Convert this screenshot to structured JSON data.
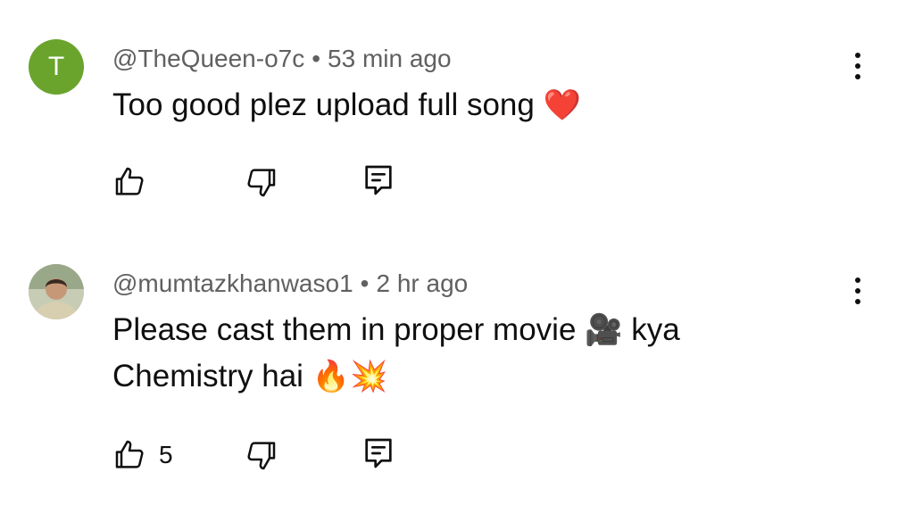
{
  "comments": [
    {
      "avatar_letter": "T",
      "avatar_color": "#6aa42d",
      "handle": "@TheQueen-o7c",
      "separator": "•",
      "time": "53 min ago",
      "text": "Too good plez upload full song",
      "emoji": "❤️",
      "like_count": ""
    },
    {
      "avatar_letter": "",
      "handle": "@mumtazkhanwaso1",
      "separator": "•",
      "time": "2 hr ago",
      "text_line1": "Please cast them in proper movie",
      "emoji1": "🎥",
      "text_mid": "kya",
      "text_line2": "Chemistry hai",
      "emoji2": "🔥",
      "emoji3": "💥",
      "like_count": "5"
    }
  ],
  "icons": {
    "like": "thumbs-up-icon",
    "dislike": "thumbs-down-icon",
    "reply": "reply-icon",
    "more": "more-vert-icon"
  }
}
